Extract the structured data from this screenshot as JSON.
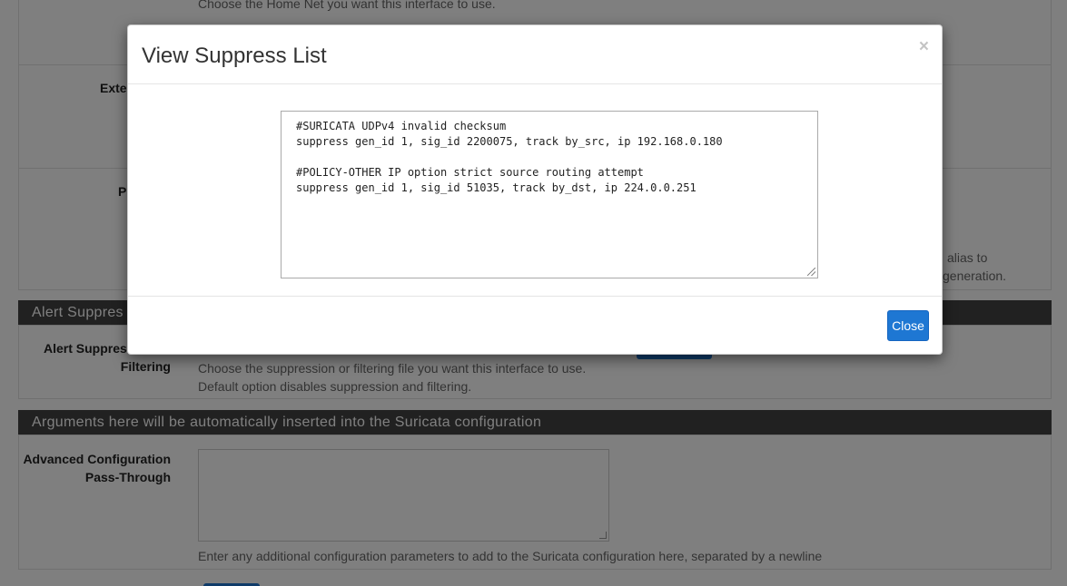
{
  "background": {
    "home_net_help": "Choose the Home Net you want this interface to use.",
    "external_label": "Exte",
    "pass_label": "P",
    "pass_help_line1": "alias to",
    "pass_help_line2": "generation.",
    "alert_suppression_heading": "Alert Suppres",
    "alert_suppress_label_line1": "Alert Suppress",
    "alert_suppress_label_line2": "Filtering",
    "alert_suppress_help_line1": "Choose the suppression or filtering file you want this interface to use.",
    "alert_suppress_help_line2": "Default option disables suppression and filtering.",
    "args_heading": "Arguments here will be automatically inserted into the Suricata configuration",
    "adv_config_label_line1": "Advanced Configuration",
    "adv_config_label_line2": "Pass-Through",
    "adv_config_value": "",
    "adv_config_help": "Enter any additional configuration parameters to add to the Suricata configuration here, separated by a newline"
  },
  "modal": {
    "title": "View Suppress List",
    "close_x": "×",
    "suppress_list": "#SURICATA UDPv4 invalid checksum\nsuppress gen_id 1, sig_id 2200075, track by_src, ip 192.168.0.180\n\n#POLICY-OTHER IP option strict source routing attempt\nsuppress gen_id 1, sig_id 51035, track by_dst, ip 224.0.0.251",
    "close_button": "Close"
  },
  "colors": {
    "primary": "#1e77d3",
    "panel_heading": "#424242",
    "backdrop": "rgba(0,0,0,0.5)"
  }
}
